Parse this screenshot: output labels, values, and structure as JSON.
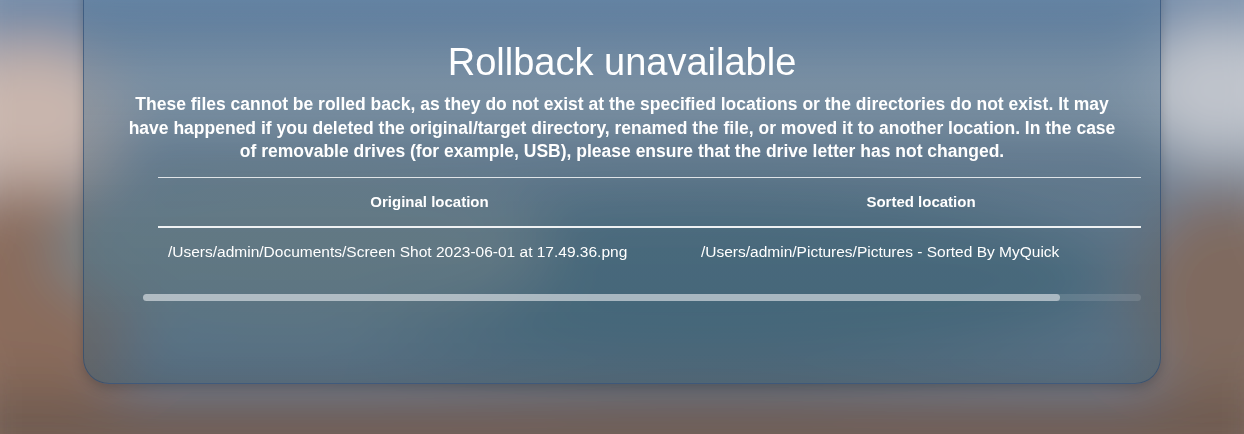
{
  "dialog": {
    "title": "Rollback unavailable",
    "message": "These files cannot be rolled back, as they do not exist at the specified locations or the directories do not exist. It may have happened if you deleted the original/target directory, renamed the file, or moved it to another location. In the case of removable drives (for example, USB), please ensure that the drive letter has not changed.",
    "table": {
      "columns": [
        "Original location",
        "Sorted location"
      ],
      "rows": [
        [
          "/Users/admin/Documents/Screen Shot 2023-06-01 at 17.49.36.png",
          "/Users/admin/Pictures/Pictures - Sorted By MyQuick"
        ]
      ]
    }
  }
}
